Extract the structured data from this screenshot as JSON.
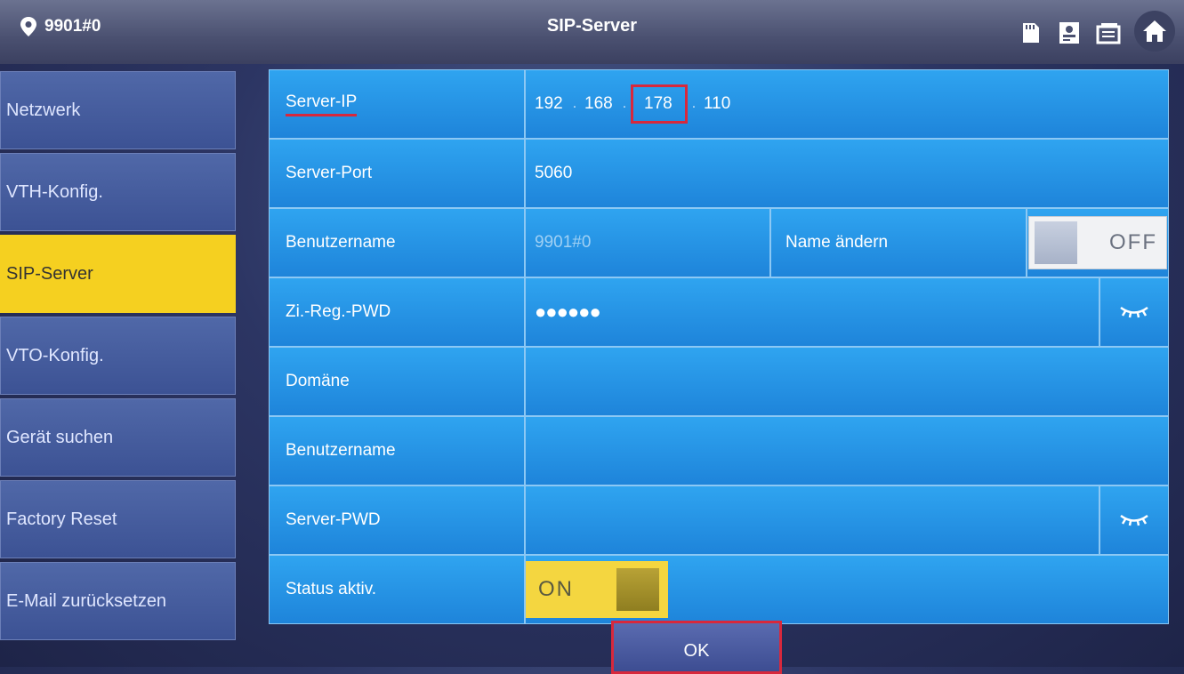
{
  "header": {
    "device_id": "9901#0",
    "title": "SIP-Server",
    "icons": [
      "location-icon",
      "sd-card-icon",
      "contact-card-icon",
      "message-icon",
      "home-icon"
    ]
  },
  "sidebar": {
    "items": [
      {
        "label": "Netzwerk"
      },
      {
        "label": "VTH-Konfig."
      },
      {
        "label": "SIP-Server",
        "active": true
      },
      {
        "label": "VTO-Konfig."
      },
      {
        "label": "Gerät suchen"
      },
      {
        "label": "Factory Reset"
      },
      {
        "label": "E-Mail zurücksetzen"
      }
    ]
  },
  "form": {
    "server_ip": {
      "label": "Server-IP",
      "octets": [
        "192",
        "168",
        "178",
        "110"
      ]
    },
    "server_port": {
      "label": "Server-Port",
      "value": "5060"
    },
    "username": {
      "label": "Benutzername",
      "value": "9901#0",
      "name_change_label": "Name ändern",
      "toggle": "OFF"
    },
    "room_pwd": {
      "label": "Zi.-Reg.-PWD",
      "value": "●●●●●●"
    },
    "domain": {
      "label": "Domäne",
      "value": ""
    },
    "username2": {
      "label": "Benutzername",
      "value": ""
    },
    "server_pwd": {
      "label": "Server-PWD",
      "value": ""
    },
    "status": {
      "label": "Status aktiv.",
      "toggle": "ON"
    }
  },
  "ok_label": "OK",
  "colors": {
    "accent_yellow": "#f5d020",
    "row_blue": "#1e84da",
    "highlight_red": "#d8283c"
  }
}
